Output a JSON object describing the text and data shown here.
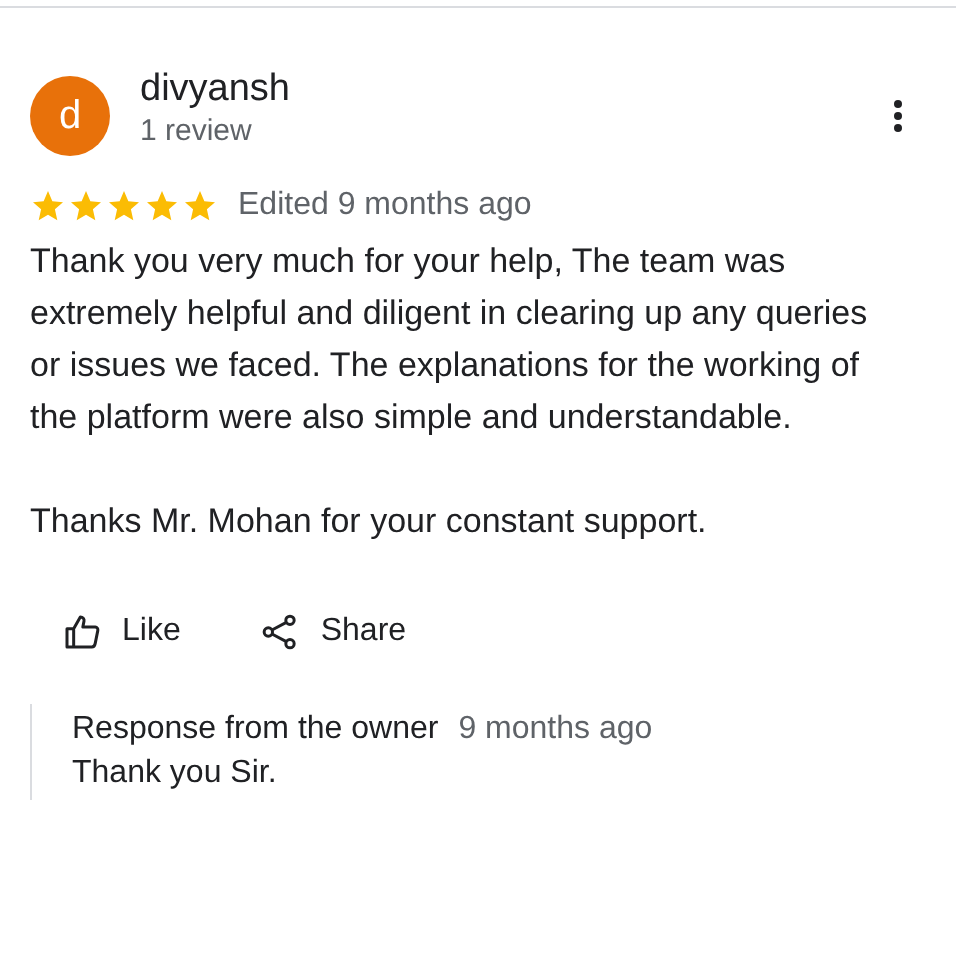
{
  "reviewer": {
    "initial": "d",
    "name": "divyansh",
    "review_count": "1 review"
  },
  "rating": {
    "stars": 5,
    "edited": "Edited 9 months ago"
  },
  "review_paragraphs": [
    "Thank you very much for your help, The team was extremely helpful and diligent in clearing up any queries or issues we faced. The explanations for the working of the platform were also simple and understandable.",
    "Thanks Mr. Mohan for your constant support."
  ],
  "actions": [
    {
      "kind": "like",
      "label": "Like"
    },
    {
      "kind": "share",
      "label": "Share"
    }
  ],
  "owner_response": {
    "title": "Response from the owner",
    "time": "9 months ago",
    "text": "Thank you Sir."
  }
}
